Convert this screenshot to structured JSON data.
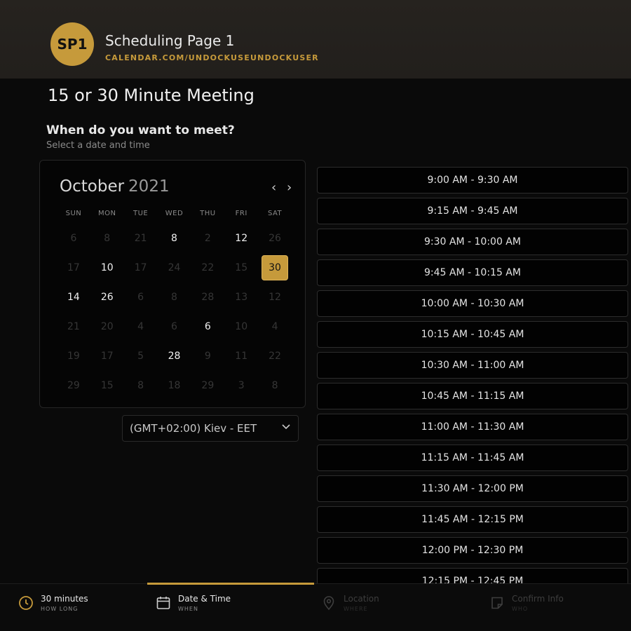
{
  "header": {
    "avatar_text": "SP1",
    "page_name": "Scheduling Page 1",
    "url": "CALENDAR.COM/UNDOCKUSEUNDOCKUSER"
  },
  "main": {
    "title": "15 or 30 Minute Meeting",
    "question": "When do you want to meet?",
    "subtext": "Select a date and time"
  },
  "calendar": {
    "month": "October",
    "year": "2021",
    "prev_label": "‹",
    "next_label": "›",
    "weekdays": [
      "SUN",
      "MON",
      "TUE",
      "WED",
      "THU",
      "FRI",
      "SAT"
    ],
    "weeks": [
      [
        "6",
        "8",
        "21",
        "8",
        "2",
        "12",
        "26"
      ],
      [
        "17",
        "10",
        "17",
        "24",
        "22",
        "15",
        "30"
      ],
      [
        "14",
        "26",
        "6",
        "8",
        "28",
        "13",
        "12"
      ],
      [
        "21",
        "20",
        "4",
        "6",
        "6",
        "10",
        "4"
      ],
      [
        "19",
        "17",
        "5",
        "28",
        "9",
        "11",
        "22"
      ],
      [
        "29",
        "15",
        "8",
        "18",
        "29",
        "3",
        "8"
      ]
    ],
    "available": [
      [
        0,
        3
      ],
      [
        0,
        5
      ],
      [
        1,
        1
      ],
      [
        2,
        0
      ],
      [
        2,
        1
      ],
      [
        3,
        4
      ],
      [
        4,
        3
      ]
    ],
    "selected": [
      1,
      6
    ]
  },
  "timezone": {
    "value": "(GMT+02:00) Kiev - EET"
  },
  "time_slots": [
    "9:00 AM - 9:30 AM",
    "9:15 AM - 9:45 AM",
    "9:30 AM - 10:00 AM",
    "9:45 AM - 10:15 AM",
    "10:00 AM - 10:30 AM",
    "10:15 AM - 10:45 AM",
    "10:30 AM - 11:00 AM",
    "10:45 AM - 11:15 AM",
    "11:00 AM - 11:30 AM",
    "11:15 AM - 11:45 AM",
    "11:30 AM - 12:00 PM",
    "11:45 AM - 12:15 PM",
    "12:00 PM - 12:30 PM",
    "12:15 PM - 12:45 PM"
  ],
  "footer": {
    "steps": [
      {
        "title": "30 minutes",
        "sub": "HOW LONG",
        "icon": "clock-icon",
        "state": "done"
      },
      {
        "title": "Date & Time",
        "sub": "WHEN",
        "icon": "calendar-icon",
        "state": "active"
      },
      {
        "title": "Location",
        "sub": "WHERE",
        "icon": "location-pin-icon",
        "state": "inactive"
      },
      {
        "title": "Confirm Info",
        "sub": "WHO",
        "icon": "note-icon",
        "state": "inactive"
      }
    ]
  },
  "colors": {
    "accent": "#c69a3b",
    "background": "#0a0a0a",
    "header_bg": "#24211e"
  }
}
